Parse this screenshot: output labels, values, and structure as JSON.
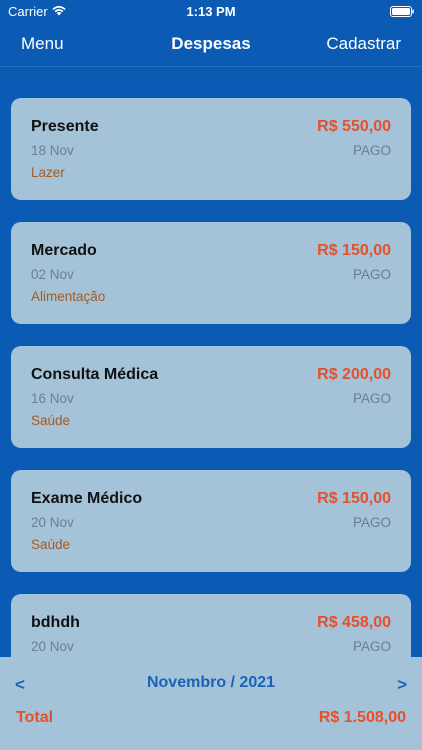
{
  "status_bar": {
    "carrier": "Carrier",
    "time": "1:13 PM"
  },
  "nav": {
    "left": "Menu",
    "title": "Despesas",
    "right": "Cadastrar"
  },
  "expenses": [
    {
      "description": "Presente",
      "value": "R$ 550,00",
      "date": "18 Nov",
      "status": "PAGO",
      "category": "Lazer"
    },
    {
      "description": "Mercado",
      "value": "R$ 150,00",
      "date": "02 Nov",
      "status": "PAGO",
      "category": "Alimentação"
    },
    {
      "description": "Consulta Médica",
      "value": "R$ 200,00",
      "date": "16 Nov",
      "status": "PAGO",
      "category": "Saúde"
    },
    {
      "description": "Exame Médico",
      "value": "R$ 150,00",
      "date": "20 Nov",
      "status": "PAGO",
      "category": "Saúde"
    },
    {
      "description": "bdhdh",
      "value": "R$ 458,00",
      "date": "20 Nov",
      "status": "PAGO",
      "category": ""
    }
  ],
  "footer": {
    "prev": "<",
    "period": "Novembro / 2021",
    "next": ">",
    "total_label": "Total",
    "total_value": "R$ 1.508,00"
  },
  "colors": {
    "background": "#0b5ab4",
    "card": "#a4c2d8",
    "value": "#e8502a",
    "category": "#a85a1f",
    "accent": "#1a64b5"
  },
  "icons": [
    "wifi-icon",
    "battery-icon"
  ]
}
